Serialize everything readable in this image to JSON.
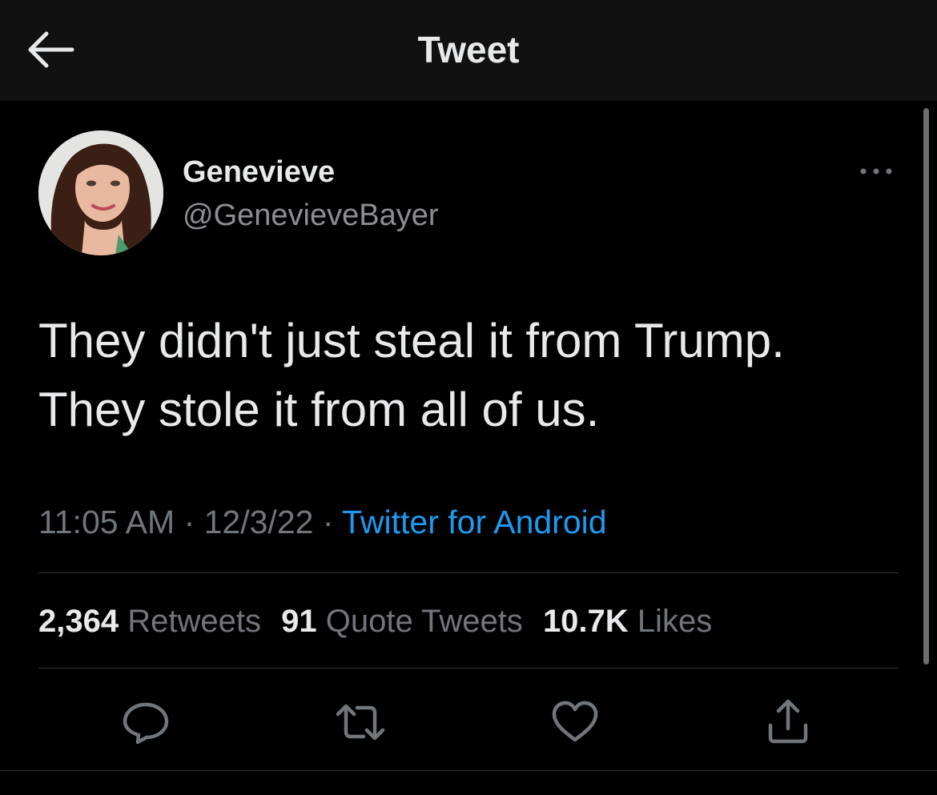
{
  "header": {
    "title": "Tweet",
    "back_icon": "arrow-left-icon"
  },
  "author": {
    "display_name": "Genevieve",
    "handle": "@GenevieveBayer",
    "more_icon": "more-dots-icon"
  },
  "tweet": {
    "lines": [
      "They didn't just steal it from Trump.",
      "They stole it from all of us."
    ]
  },
  "meta": {
    "time": "11:05 AM",
    "separator": " · ",
    "date": "12/3/22",
    "source": "Twitter for Android"
  },
  "stats": {
    "retweets_count": "2,364",
    "retweets_label": "Retweets",
    "quotes_count": "91",
    "quotes_label": "Quote Tweets",
    "likes_count": "10.7K",
    "likes_label": "Likes"
  },
  "actions": {
    "icons": [
      "reply-icon",
      "retweet-icon",
      "like-icon",
      "share-icon"
    ]
  },
  "colors": {
    "background": "#000000",
    "header_background": "#111111",
    "text_primary": "#e7e9ea",
    "text_secondary": "#71767b",
    "link": "#1d9bf0",
    "divider": "#2f3336"
  }
}
